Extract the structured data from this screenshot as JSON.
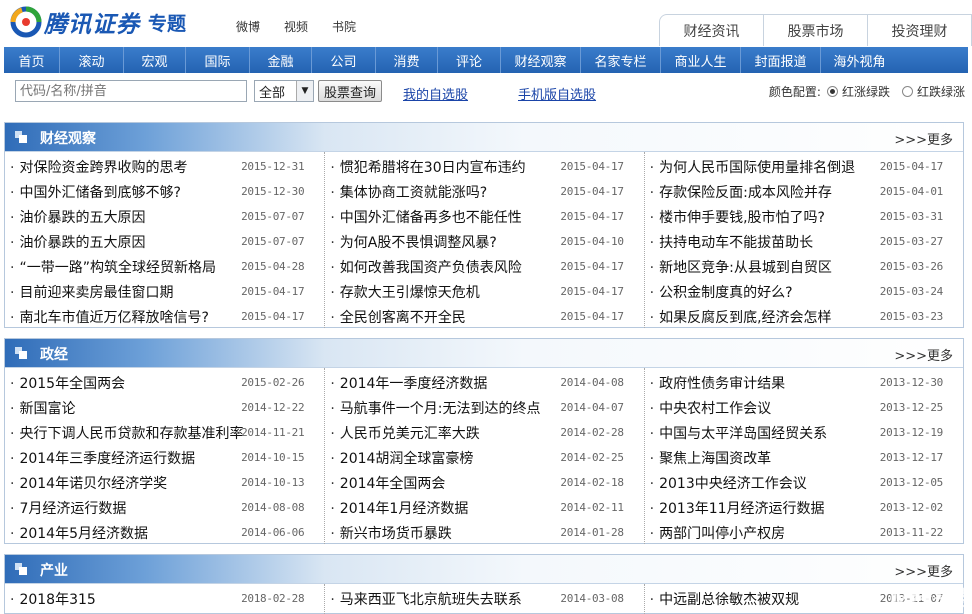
{
  "header": {
    "logo_text": "腾讯证券",
    "logo_sub": "专题",
    "top_links": [
      "微博",
      "视频",
      "书院"
    ],
    "right_tabs": [
      "财经资讯",
      "股票市场",
      "投资理财"
    ]
  },
  "nav": [
    "首页",
    "滚动",
    "宏观",
    "国际",
    "金融",
    "公司",
    "消费",
    "评论",
    "财经观察",
    "名家专栏",
    "商业人生",
    "封面报道",
    "海外视角"
  ],
  "search": {
    "placeholder": "代码/名称/拼音",
    "select_value": "全部",
    "query_label": "股票查询",
    "my_watchlist": "我的自选股",
    "mobile_watchlist": "手机版自选股",
    "color_label": "颜色配置:",
    "option_red_up": "红涨绿跌",
    "option_red_down": "红跌绿涨"
  },
  "sections": [
    {
      "title": "财经观察",
      "more": ">>>更多",
      "columns": [
        [
          {
            "title": "对保险资金跨界收购的思考",
            "date": "2015-12-31"
          },
          {
            "title": "中国外汇储备到底够不够?",
            "date": "2015-12-30"
          },
          {
            "title": "油价暴跌的五大原因",
            "date": "2015-07-07"
          },
          {
            "title": "油价暴跌的五大原因",
            "date": "2015-07-07"
          },
          {
            "title": "“一带一路”构筑全球经贸新格局",
            "date": "2015-04-28"
          },
          {
            "title": "目前迎来卖房最佳窗口期",
            "date": "2015-04-17"
          },
          {
            "title": "南北车市值近万亿释放啥信号?",
            "date": "2015-04-17"
          }
        ],
        [
          {
            "title": "惯犯希腊将在30日内宣布违约",
            "date": "2015-04-17"
          },
          {
            "title": "集体协商工资就能涨吗?",
            "date": "2015-04-17"
          },
          {
            "title": "中国外汇储备再多也不能任性",
            "date": "2015-04-17"
          },
          {
            "title": "为何A股不畏惧调整风暴?",
            "date": "2015-04-10"
          },
          {
            "title": "如何改善我国资产负债表风险",
            "date": "2015-04-17"
          },
          {
            "title": "存款大王引爆惊天危机",
            "date": "2015-04-17"
          },
          {
            "title": "全民创客离不开全民",
            "date": "2015-04-17"
          }
        ],
        [
          {
            "title": "为何人民币国际使用量排名倒退",
            "date": "2015-04-17"
          },
          {
            "title": "存款保险反面:成本风险并存",
            "date": "2015-04-01"
          },
          {
            "title": "楼市伸手要钱,股市怕了吗?",
            "date": "2015-03-31"
          },
          {
            "title": "扶持电动车不能拔苗助长",
            "date": "2015-03-27"
          },
          {
            "title": "新地区竞争:从县城到自贸区",
            "date": "2015-03-26"
          },
          {
            "title": "公积金制度真的好么?",
            "date": "2015-03-24"
          },
          {
            "title": "如果反腐反到底,经济会怎样",
            "date": "2015-03-23"
          }
        ]
      ]
    },
    {
      "title": "政经",
      "more": ">>>更多",
      "columns": [
        [
          {
            "title": "2015年全国两会",
            "date": "2015-02-26"
          },
          {
            "title": "新国富论",
            "date": "2014-12-22"
          },
          {
            "title": "央行下调人民币贷款和存款基准利率",
            "date": "2014-11-21"
          },
          {
            "title": "2014年三季度经济运行数据",
            "date": "2014-10-15"
          },
          {
            "title": "2014年诺贝尔经济学奖",
            "date": "2014-10-13"
          },
          {
            "title": "7月经济运行数据",
            "date": "2014-08-08"
          },
          {
            "title": "2014年5月经济数据",
            "date": "2014-06-06"
          }
        ],
        [
          {
            "title": "2014年一季度经济数据",
            "date": "2014-04-08"
          },
          {
            "title": "马航事件一个月:无法到达的终点",
            "date": "2014-04-07"
          },
          {
            "title": "人民币兑美元汇率大跌",
            "date": "2014-02-28"
          },
          {
            "title": "2014胡润全球富豪榜",
            "date": "2014-02-25"
          },
          {
            "title": "2014年全国两会",
            "date": "2014-02-18"
          },
          {
            "title": "2014年1月经济数据",
            "date": "2014-02-11"
          },
          {
            "title": "新兴市场货币暴跌",
            "date": "2014-01-28"
          }
        ],
        [
          {
            "title": "政府性债务审计结果",
            "date": "2013-12-30"
          },
          {
            "title": "中央农村工作会议",
            "date": "2013-12-25"
          },
          {
            "title": "中国与太平洋岛国经贸关系",
            "date": "2013-12-19"
          },
          {
            "title": "聚焦上海国资改革",
            "date": "2013-12-17"
          },
          {
            "title": "2013中央经济工作会议",
            "date": "2013-12-05"
          },
          {
            "title": "2013年11月经济运行数据",
            "date": "2013-12-02"
          },
          {
            "title": "两部门叫停小产权房",
            "date": "2013-11-22"
          }
        ]
      ]
    },
    {
      "title": "产业",
      "more": ">>>更多",
      "columns": [
        [
          {
            "title": "2018年315",
            "date": "2018-02-28"
          }
        ],
        [
          {
            "title": "马来西亚飞北京航班失去联系",
            "date": "2014-03-08"
          }
        ],
        [
          {
            "title": "中远副总徐敏杰被双规",
            "date": "2013-11-07"
          }
        ]
      ]
    }
  ],
  "watermark": "财经头条",
  "colors": {
    "nav_bg": "#2a69b6",
    "brand_blue": "#1a58b4",
    "link_blue": "#1a44a8"
  }
}
